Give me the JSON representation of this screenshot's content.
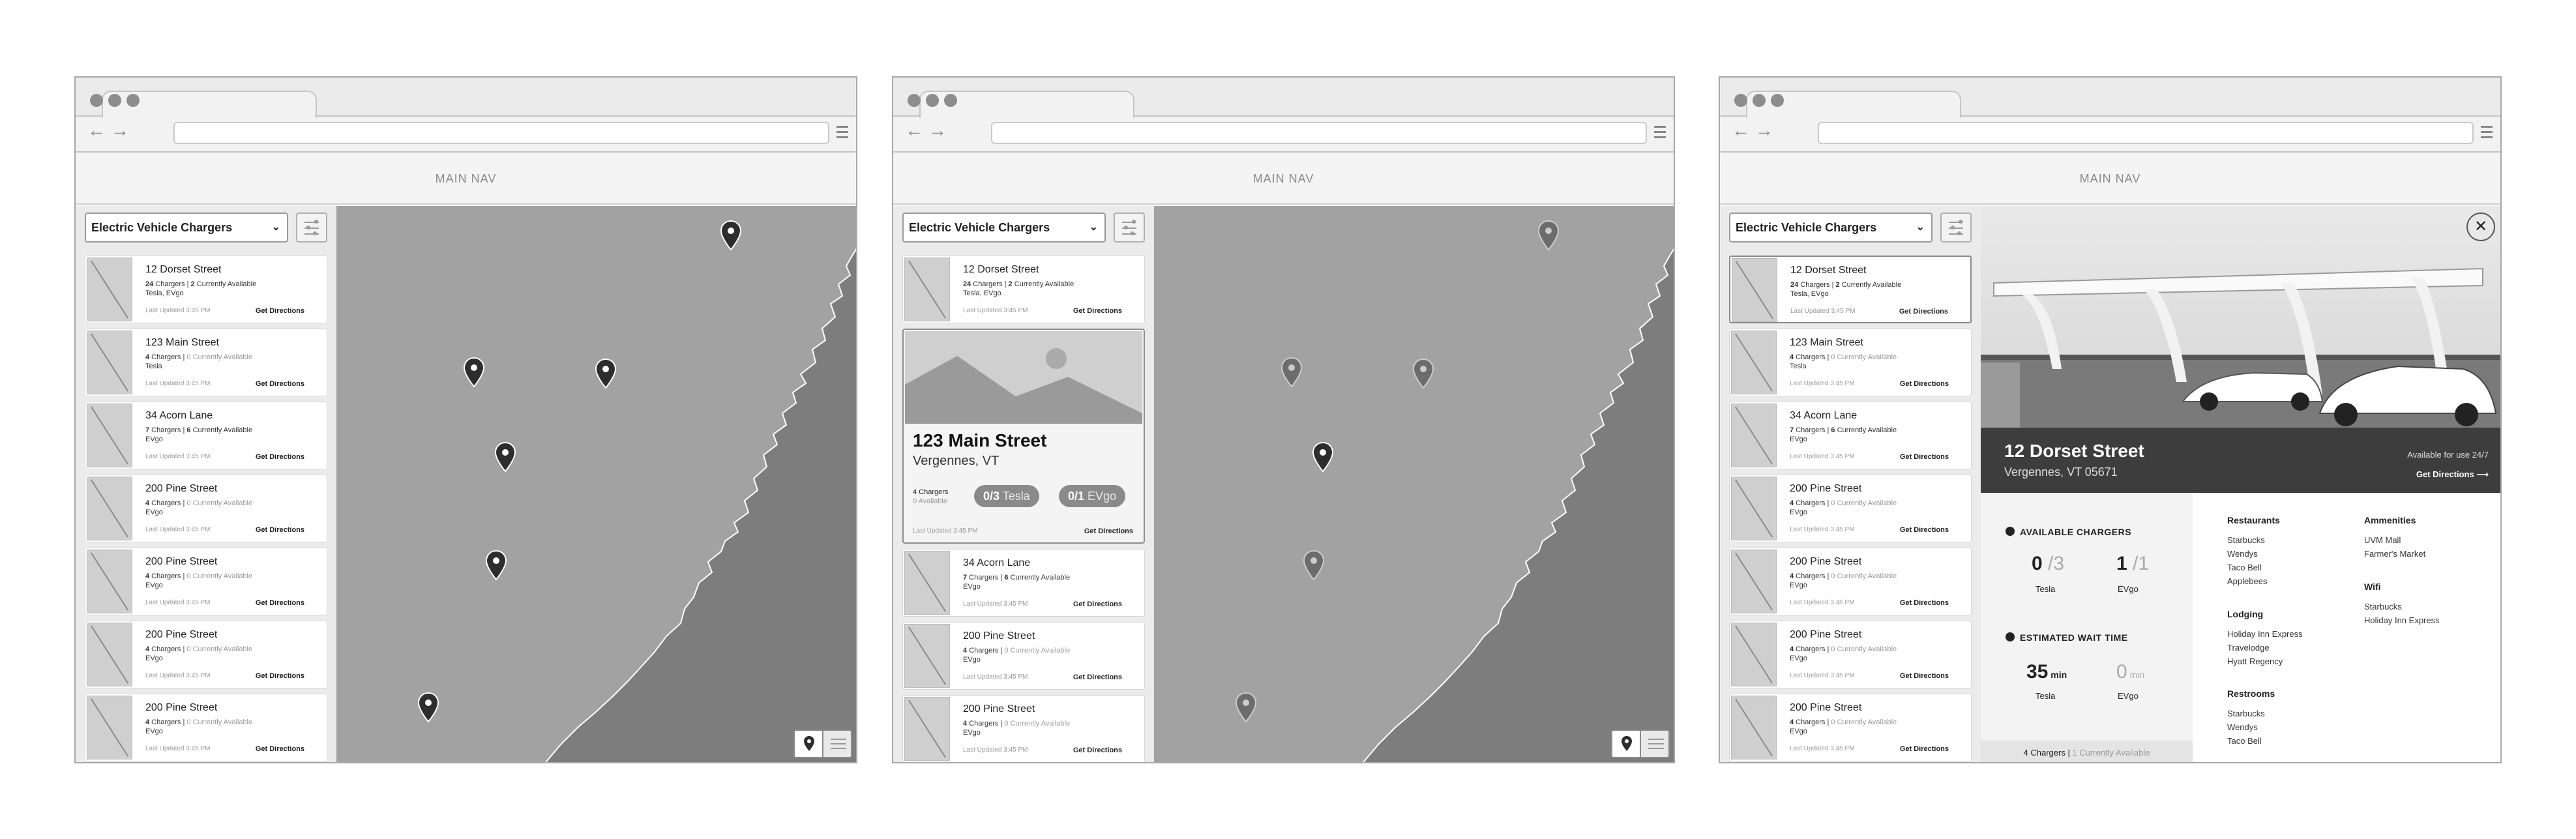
{
  "nav_label": "MAIN NAV",
  "filter_select": "Electric Vehicle Chargers",
  "get_directions": "Get Directions",
  "chargers": [
    {
      "address": "12 Dorset Street",
      "count": "24",
      "count_label": " Chargers | ",
      "avail": "2",
      "avail_label": " Currently Available",
      "networks": "Tesla, EVgo",
      "updated": "Last Updated 3:45 PM"
    },
    {
      "address": "123 Main Street",
      "count": "4",
      "count_label": " Chargers | ",
      "avail": "0",
      "avail_label": " Currently Available",
      "networks": "Tesla",
      "updated": "Last Updated 3:45 PM"
    },
    {
      "address": "34 Acorn Lane",
      "count": "7",
      "count_label": " Chargers | ",
      "avail": "6",
      "avail_label": " Currently Available",
      "networks": "EVgo",
      "updated": "Last Updated 3:45 PM"
    },
    {
      "address": "200 Pine Street",
      "count": "4",
      "count_label": " Chargers | ",
      "avail": "0",
      "avail_label": " Currently Available",
      "networks": "EVgo",
      "updated": "Last Updated 3:45 PM"
    },
    {
      "address": "200 Pine Street",
      "count": "4",
      "count_label": " Chargers | ",
      "avail": "0",
      "avail_label": " Currently Available",
      "networks": "EVgo",
      "updated": "Last Updated 3:45 PM"
    },
    {
      "address": "200 Pine Street",
      "count": "4",
      "count_label": " Chargers | ",
      "avail": "0",
      "avail_label": " Currently Available",
      "networks": "EVgo",
      "updated": "Last Updated 3:45 PM"
    },
    {
      "address": "200 Pine Street",
      "count": "4",
      "count_label": " Chargers | ",
      "avail": "0",
      "avail_label": " Currently Available",
      "networks": "EVgo",
      "updated": "Last Updated 3:45 PM"
    }
  ],
  "expanded": {
    "title": "123 Main Street",
    "subtitle": "Vergennes, VT",
    "chargers_count": "4 Chargers",
    "chargers_avail": "0 Available",
    "tesla_ratio": "0/3",
    "tesla_label": "Tesla",
    "evgo_ratio": "0/1",
    "evgo_label": "EVgo",
    "updated": "Last Updated 3:45 PM"
  },
  "detail": {
    "title": "12 Dorset Street",
    "subtitle": "Vergennes, VT 05671",
    "availability": "Available for use 24/7",
    "directions": "Get Directions",
    "available_heading": "AVAILABLE CHARGERS",
    "tesla_avail": "0",
    "tesla_total": " /3",
    "evgo_avail": "1",
    "evgo_total": " /1",
    "tesla_label": "Tesla",
    "evgo_label": "EVgo",
    "wait_heading": "ESTIMATED WAIT TIME",
    "tesla_wait": "35",
    "tesla_wait_unit": " min",
    "evgo_wait": "0",
    "evgo_wait_unit": " min",
    "footer_count": "4 Chargers | ",
    "footer_avail": "1 Currently Available",
    "amenities": {
      "restaurants": {
        "heading": "Restaurants",
        "items": [
          "Starbucks",
          "Wendys",
          "Taco Bell",
          "Applebees"
        ]
      },
      "lodging": {
        "heading": "Lodging",
        "items": [
          "Holiday Inn Express",
          "Travelodge",
          "Hyatt Regency"
        ]
      },
      "restrooms": {
        "heading": "Restrooms",
        "items": [
          "Starbucks",
          "Wendys",
          "Taco Bell"
        ]
      },
      "ammenities": {
        "heading": "Ammenities",
        "items": [
          "UVM Mall",
          "Farmer's Market"
        ]
      },
      "wifi": {
        "heading": "Wifi",
        "items": [
          "Starbucks",
          "Holiday Inn Express"
        ]
      }
    }
  },
  "icons": {
    "pin": "map-pin-icon",
    "list": "list-icon",
    "filter": "filter-sliders-icon",
    "close": "close-icon",
    "arrow": "arrow-right-icon"
  }
}
